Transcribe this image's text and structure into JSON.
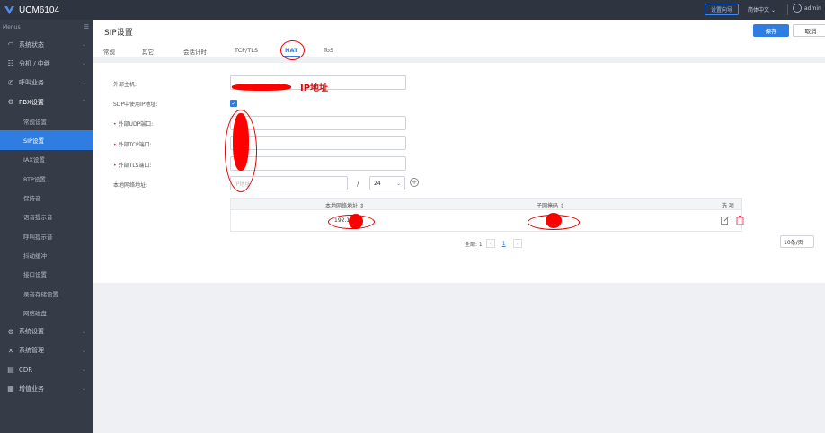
{
  "topbar": {
    "app_name": "UCM6104",
    "setup_wizard": "设置向导",
    "language": "简体中文",
    "user": "admin"
  },
  "sidebar": {
    "header": "Menus",
    "items": [
      {
        "label": "系统状态",
        "icon": "dashboard-icon"
      },
      {
        "label": "分机 / 中继",
        "icon": "extension-icon"
      },
      {
        "label": "呼叫业务",
        "icon": "phone-icon"
      },
      {
        "label": "PBX设置",
        "icon": "gear-icon"
      }
    ],
    "sub_items": [
      "常规设置",
      "SIP设置",
      "IAX设置",
      "RTP设置",
      "保持音",
      "语音提示音",
      "呼叫提示音",
      "抖动缓冲",
      "接口设置",
      "录音存储设置",
      "网络磁盘"
    ],
    "bottom_items": [
      {
        "label": "系统设置",
        "icon": "settings-icon"
      },
      {
        "label": "系统管理",
        "icon": "tools-icon"
      },
      {
        "label": "CDR",
        "icon": "document-icon"
      },
      {
        "label": "增值业务",
        "icon": "grid-icon"
      }
    ]
  },
  "header": {
    "title": "SIP设置",
    "save": "保存",
    "cancel": "取消",
    "tabs": [
      "常规",
      "其它",
      "会话计时",
      "TCP/TLS",
      "NAT",
      "ToS"
    ]
  },
  "form": {
    "external_host_label": "外部主机:",
    "sdp_use_ip_label": "SDP中使用IP地址:",
    "ext_udp_label": "外部UDP端口:",
    "ext_tcp_label": "外部TCP端口:",
    "ext_tls_label": "外部TLS端口:",
    "local_net_label": "本地网络地址:",
    "ip_placeholder": "IP地址",
    "slash": "/",
    "mask_value": "24"
  },
  "table": {
    "headers": [
      "本地网络地址",
      "子网掩码",
      "选 项"
    ],
    "row_ip": "192.16"
  },
  "pager": {
    "total": "全部: 1",
    "page": "1",
    "per_page": "10条/页"
  },
  "annotation": {
    "label": "IP地址"
  }
}
